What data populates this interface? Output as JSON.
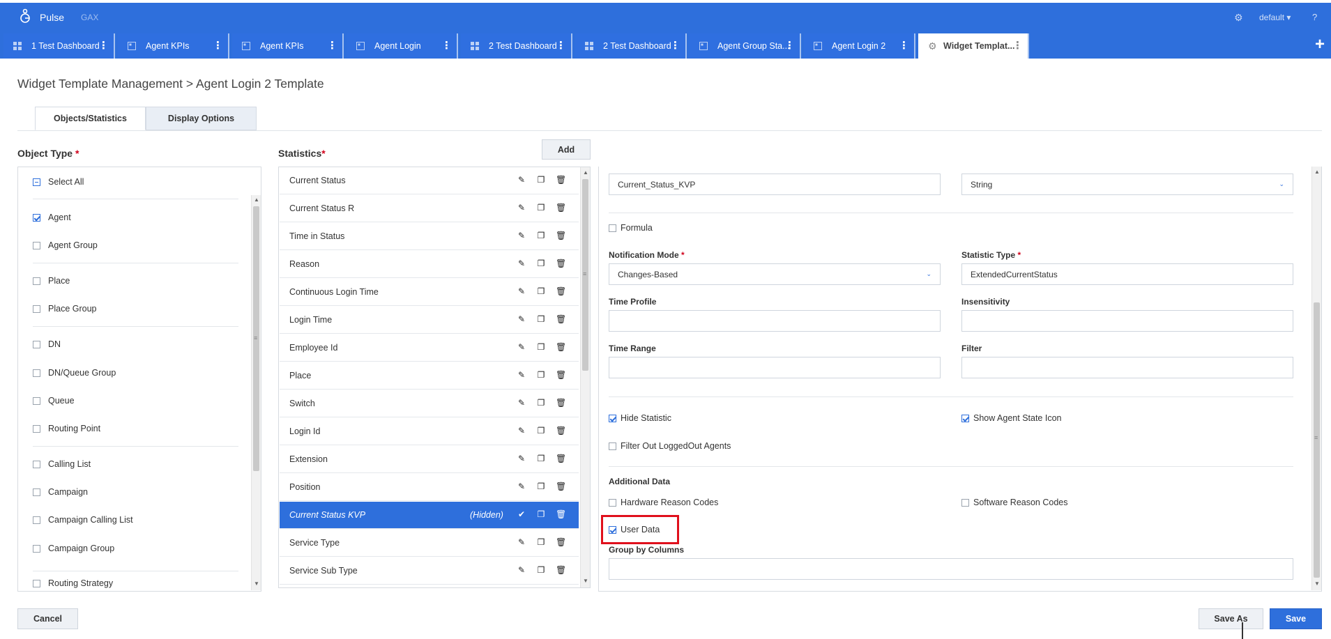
{
  "app": {
    "brand": "Pulse",
    "secondary": "GAX",
    "tenant": "default",
    "help": "?"
  },
  "tabs": [
    {
      "label": "1 Test Dashboard",
      "icon": "dashboard-icon"
    },
    {
      "label": "Agent KPIs",
      "icon": "widget-icon"
    },
    {
      "label": "Agent KPIs",
      "icon": "widget-icon"
    },
    {
      "label": "Agent Login",
      "icon": "widget-icon"
    },
    {
      "label": "2 Test Dashboard",
      "icon": "dashboard-icon"
    },
    {
      "label": "2 Test Dashboard",
      "icon": "dashboard-icon"
    },
    {
      "label": "Agent Group Sta...",
      "icon": "widget-icon"
    },
    {
      "label": "Agent Login 2",
      "icon": "widget-icon"
    },
    {
      "label": "Widget Templat...",
      "icon": "gear-icon",
      "active": true
    }
  ],
  "page": {
    "title": "Widget Template Management > Agent Login 2 Template"
  },
  "subtabs": {
    "objects": "Objects/Statistics",
    "display": "Display Options"
  },
  "object_type": {
    "title": "Object Type",
    "required": "*",
    "select_all": "Select All",
    "items": [
      {
        "label": "Agent",
        "checked": true
      },
      {
        "label": "Agent Group",
        "checked": false
      },
      {
        "label": "Place",
        "checked": false
      },
      {
        "label": "Place Group",
        "checked": false
      },
      {
        "label": "DN",
        "checked": false
      },
      {
        "label": "DN/Queue Group",
        "checked": false
      },
      {
        "label": "Queue",
        "checked": false
      },
      {
        "label": "Routing Point",
        "checked": false
      },
      {
        "label": "Calling List",
        "checked": false
      },
      {
        "label": "Campaign",
        "checked": false
      },
      {
        "label": "Campaign Calling List",
        "checked": false
      },
      {
        "label": "Campaign Group",
        "checked": false
      },
      {
        "label": "Routing Strategy",
        "checked": false
      }
    ]
  },
  "statistics": {
    "title": "Statistics",
    "required": "*",
    "add_label": "Add",
    "items": [
      {
        "name": "Current Status"
      },
      {
        "name": "Current Status R"
      },
      {
        "name": "Time in Status"
      },
      {
        "name": "Reason"
      },
      {
        "name": "Continuous Login Time"
      },
      {
        "name": "Login Time"
      },
      {
        "name": "Employee Id"
      },
      {
        "name": "Place"
      },
      {
        "name": "Switch"
      },
      {
        "name": "Login Id"
      },
      {
        "name": "Extension"
      },
      {
        "name": "Position"
      },
      {
        "name": "Current Status KVP",
        "hidden": "(Hidden)",
        "selected": true
      },
      {
        "name": "Service Type"
      },
      {
        "name": "Service Sub Type"
      }
    ]
  },
  "details": {
    "alias_value": "Current_Status_KVP",
    "display_format_value": "String",
    "formula_label": "Formula",
    "notification_mode_label": "Notification Mode",
    "notification_mode_value": "Changes-Based",
    "statistic_type_label": "Statistic Type",
    "statistic_type_value": "ExtendedCurrentStatus",
    "required": "*",
    "time_profile_label": "Time Profile",
    "insensitivity_label": "Insensitivity",
    "time_range_label": "Time Range",
    "filter_label": "Filter",
    "hide_statistic_label": "Hide Statistic",
    "show_agent_state_icon_label": "Show Agent State Icon",
    "filter_out_label": "Filter Out LoggedOut Agents",
    "additional_data_label": "Additional Data",
    "hardware_reason_label": "Hardware Reason Codes",
    "software_reason_label": "Software Reason Codes",
    "user_data_label": "User Data",
    "group_by_label": "Group by Columns"
  },
  "footer": {
    "cancel": "Cancel",
    "save_as": "Save As",
    "save": "Save"
  },
  "colors": {
    "brand": "#2e6fdc",
    "highlight": "#e0101c"
  }
}
